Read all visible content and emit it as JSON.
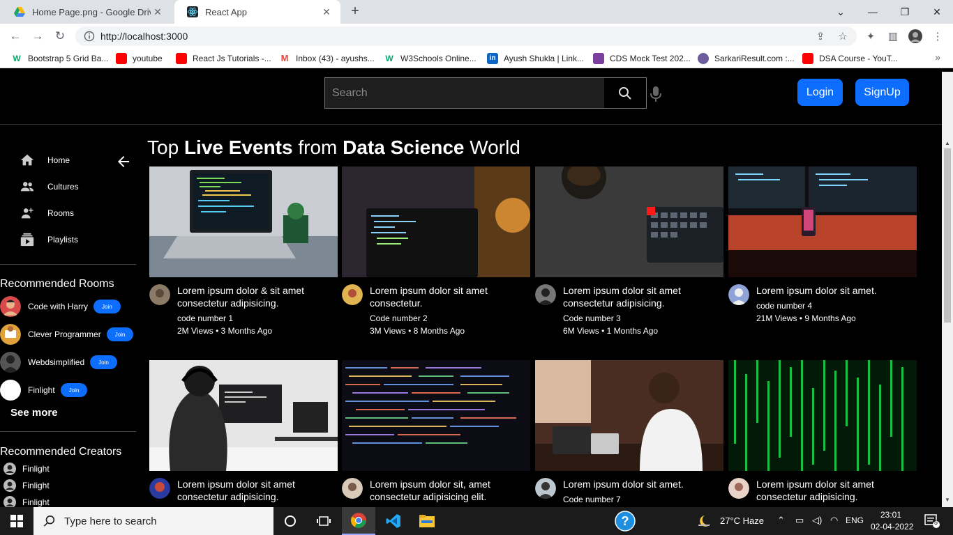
{
  "browser": {
    "tabs": [
      {
        "title": "Home Page.png - Google Drive",
        "icon": "google-drive-icon"
      },
      {
        "title": "React App",
        "icon": "react-icon"
      }
    ],
    "url": "http://localhost:3000",
    "bookmarks": [
      {
        "label": "Bootstrap 5 Grid Ba...",
        "icon": "w3schools-icon"
      },
      {
        "label": "youtube",
        "icon": "youtube-icon"
      },
      {
        "label": "React Js Tutorials -...",
        "icon": "youtube-icon"
      },
      {
        "label": "Inbox (43) - ayushs...",
        "icon": "gmail-icon"
      },
      {
        "label": "W3Schools Online...",
        "icon": "w3schools-icon"
      },
      {
        "label": "Ayush Shukla | Link...",
        "icon": "linkedin-icon"
      },
      {
        "label": "CDS Mock Test 202...",
        "icon": "testbook-icon"
      },
      {
        "label": "SarkariResult.com :...",
        "icon": "sarkari-icon"
      },
      {
        "label": "DSA Course - YouT...",
        "icon": "youtube-icon"
      }
    ]
  },
  "header": {
    "search_placeholder": "Search",
    "login_label": "Login",
    "signup_label": "SignUp"
  },
  "sidebar": {
    "nav": [
      {
        "label": "Home",
        "icon": "home-icon"
      },
      {
        "label": "Cultures",
        "icon": "people-icon"
      },
      {
        "label": "Rooms",
        "icon": "person-add-icon"
      },
      {
        "label": "Playlists",
        "icon": "playlist-icon"
      }
    ],
    "rooms_heading": "Recommended Rooms",
    "rooms": [
      {
        "name": "Code with Harry",
        "join": "Join"
      },
      {
        "name": "Clever Programmer",
        "join": "Join"
      },
      {
        "name": "Webdsimplified",
        "join": "Join"
      },
      {
        "name": "Finlight",
        "join": "Join"
      }
    ],
    "see_more": "See more",
    "creators_heading": "Recommended Creators",
    "creators": [
      "Finlight",
      "Finlight",
      "Finlight"
    ]
  },
  "main": {
    "headline": {
      "p1": "Top ",
      "b1": "Live Events",
      "p2": " from ",
      "b2": "Data Science",
      "p3": " World"
    },
    "videos": [
      {
        "title": "Lorem ipsum dolor & sit amet consectetur adipisicing.",
        "channel": "code number 1",
        "views": "2M Views • 3 Months Ago"
      },
      {
        "title": "Lorem ipsum dolor sit amet consectetur.",
        "channel": "Code number 2",
        "views": "3M Views • 8 Months Ago"
      },
      {
        "title": "Lorem ipsum dolor sit amet consectetur adipisicing.",
        "channel": "Code number 3",
        "views": "6M Views • 1 Months Ago"
      },
      {
        "title": "Lorem ipsum dolor sit amet.",
        "channel": "code number 4",
        "views": "21M Views • 9 Months Ago"
      },
      {
        "title": "Lorem ipsum dolor sit amet consectetur adipisicing.",
        "channel": "",
        "views": ""
      },
      {
        "title": "Lorem ipsum dolor sit, amet consectetur adipisicing elit.",
        "channel": "",
        "views": ""
      },
      {
        "title": "Lorem ipsum dolor sit amet.",
        "channel": "Code number 7",
        "views": ""
      },
      {
        "title": "Lorem ipsum dolor sit amet consectetur adipisicing.",
        "channel": "",
        "views": ""
      }
    ]
  },
  "taskbar": {
    "search_placeholder": "Type here to search",
    "weather": "27°C  Haze",
    "lang": "ENG",
    "time": "23:01",
    "date": "02-04-2022",
    "notifications": "5"
  },
  "colors": {
    "accent": "#0d6efd",
    "page_bg": "#000000"
  }
}
